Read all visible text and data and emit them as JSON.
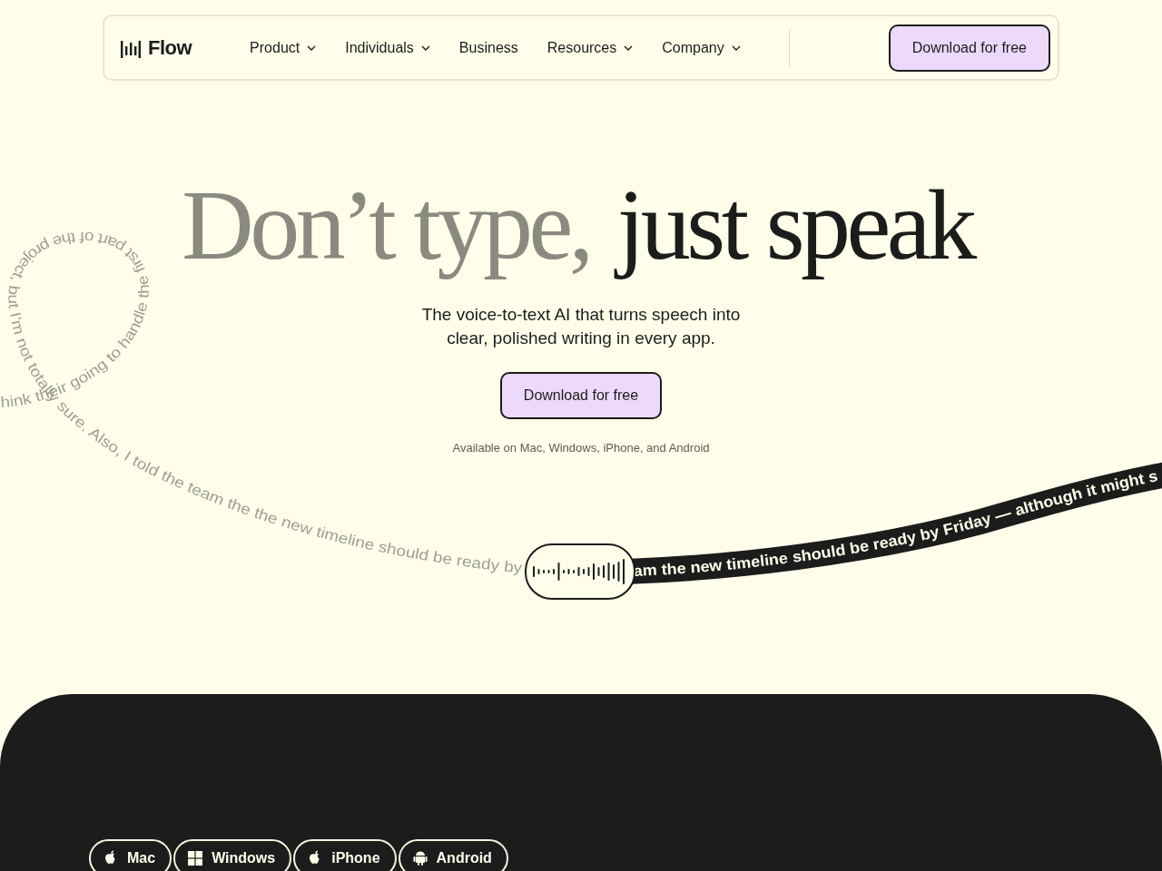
{
  "nav": {
    "logo": "Flow",
    "items": [
      {
        "label": "Product",
        "has_menu": true
      },
      {
        "label": "Individuals",
        "has_menu": true
      },
      {
        "label": "Business",
        "has_menu": false
      },
      {
        "label": "Resources",
        "has_menu": true
      },
      {
        "label": "Company",
        "has_menu": true
      }
    ],
    "cta": "Download for free"
  },
  "hero": {
    "title_muted": "Don’t type,",
    "title_strong": "just speak",
    "subtitle": "The voice-to-text AI that turns speech into clear, polished writing in every app.",
    "cta": "Download for free",
    "availability": "Available on Mac, Windows, iPhone, and Android"
  },
  "transcript": {
    "raw": "hink their going to handle the first part of the project, but I'm not totally sure. Also, I told the team the the new timeline should be ready by",
    "polished": "am the new timeline should be ready by Friday — although it might s"
  },
  "platforms": [
    {
      "label": "Mac",
      "kind": "apple"
    },
    {
      "label": "Windows",
      "kind": "windows"
    },
    {
      "label": "iPhone",
      "kind": "apple"
    },
    {
      "label": "Android",
      "kind": "android"
    }
  ]
}
